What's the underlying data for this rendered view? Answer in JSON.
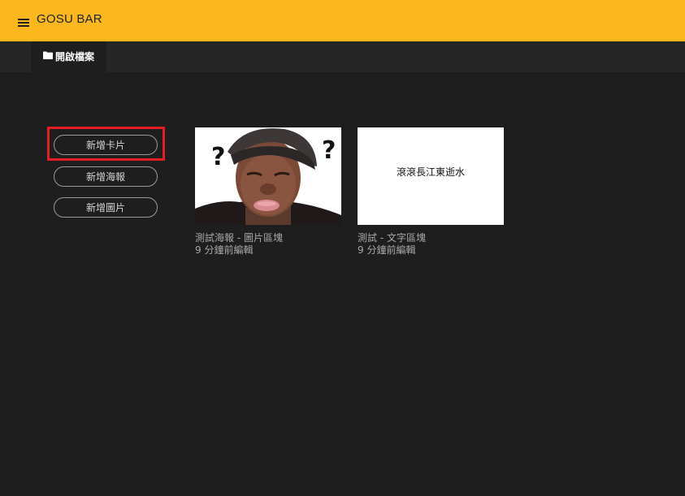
{
  "app": {
    "title": "GOSU BAR"
  },
  "tabs": [
    {
      "label": "開啟檔案",
      "icon": "folder-icon",
      "active": true
    }
  ],
  "sidebar": {
    "buttons": [
      {
        "label": "新增卡片",
        "highlighted": true
      },
      {
        "label": "新增海報"
      },
      {
        "label": "新增圖片"
      }
    ]
  },
  "cards": [
    {
      "title": "測試海報 - 圖片區塊",
      "time": "9 分鐘前編輯",
      "thumbnail": "photo-thumbnail"
    },
    {
      "title": "測試 - 文字區塊",
      "time": "9 分鐘前編輯",
      "thumbnail_text": "滾滾長江東逝水"
    }
  ],
  "colors": {
    "appbar": "#fbb81c",
    "background": "#1e1e1e",
    "tabbar": "#262626",
    "highlight": "#e21d24"
  }
}
